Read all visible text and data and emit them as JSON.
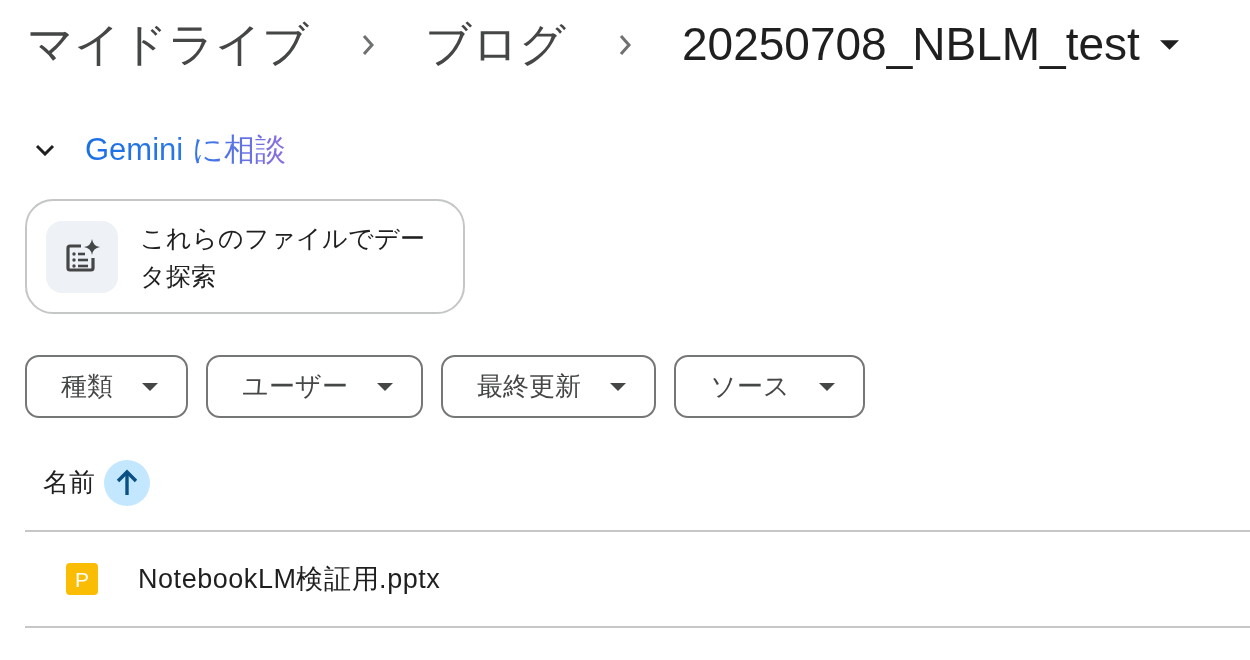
{
  "breadcrumb": [
    {
      "label": "マイドライブ",
      "kind": "folder"
    },
    {
      "label": "ブログ",
      "kind": "folder"
    },
    {
      "label": "20250708_NBLM_test",
      "kind": "current"
    }
  ],
  "gemini_panel": {
    "title": "Gemini に相談",
    "expanded": true,
    "suggestions": [
      {
        "label": "これらのファイルでデータ探索"
      }
    ]
  },
  "filters": [
    {
      "label": "種類"
    },
    {
      "label": "ユーザー"
    },
    {
      "label": "最終更新"
    },
    {
      "label": "ソース"
    }
  ],
  "file_list": {
    "columns": [
      {
        "label": "名前",
        "sort_ascending": true
      }
    ],
    "rows": [
      {
        "icon": "P",
        "name": "NotebookLM検証用.pptx",
        "kind": "presentation"
      }
    ]
  }
}
